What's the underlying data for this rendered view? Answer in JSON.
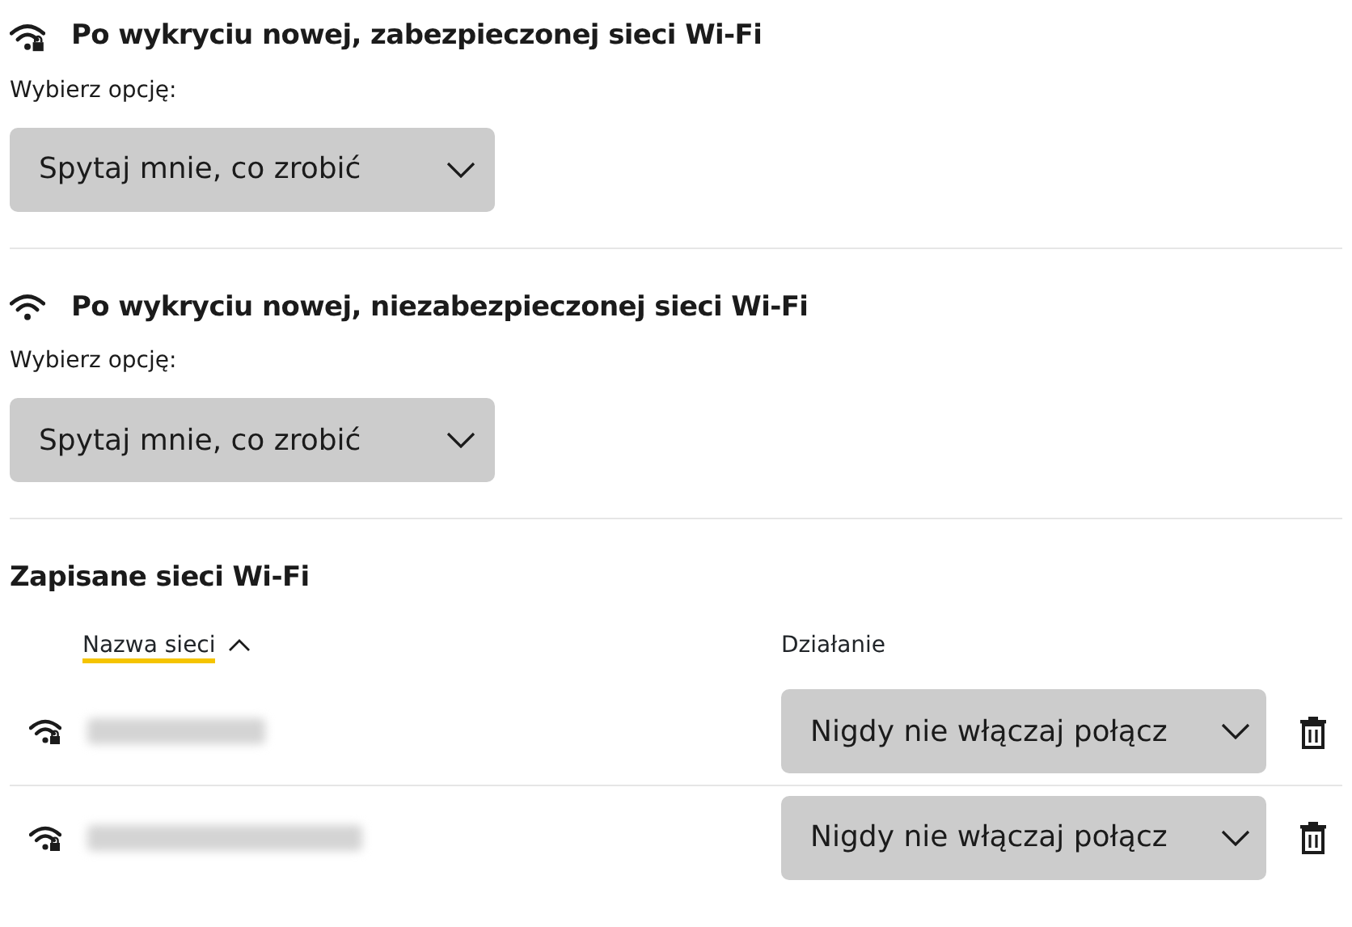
{
  "sections": [
    {
      "title": "Po wykryciu nowej, zabezpieczonej sieci Wi-Fi",
      "secured": true,
      "label": "Wybierz opcję:",
      "value": "Spytaj mnie, co zrobić"
    },
    {
      "title": "Po wykryciu nowej, niezabezpieczonej sieci Wi-Fi",
      "secured": false,
      "label": "Wybierz opcję:",
      "value": "Spytaj mnie, co zrobić"
    }
  ],
  "saved_networks": {
    "title": "Zapisane sieci Wi-Fi",
    "columns": [
      {
        "label": "Nazwa sieci",
        "sorted": true
      },
      {
        "label": "Działanie",
        "sorted": false
      }
    ],
    "rows": [
      {
        "secured": true,
        "action": "Nigdy nie włączaj połącz"
      },
      {
        "secured": true,
        "action": "Nigdy nie włączaj połącz"
      }
    ]
  }
}
